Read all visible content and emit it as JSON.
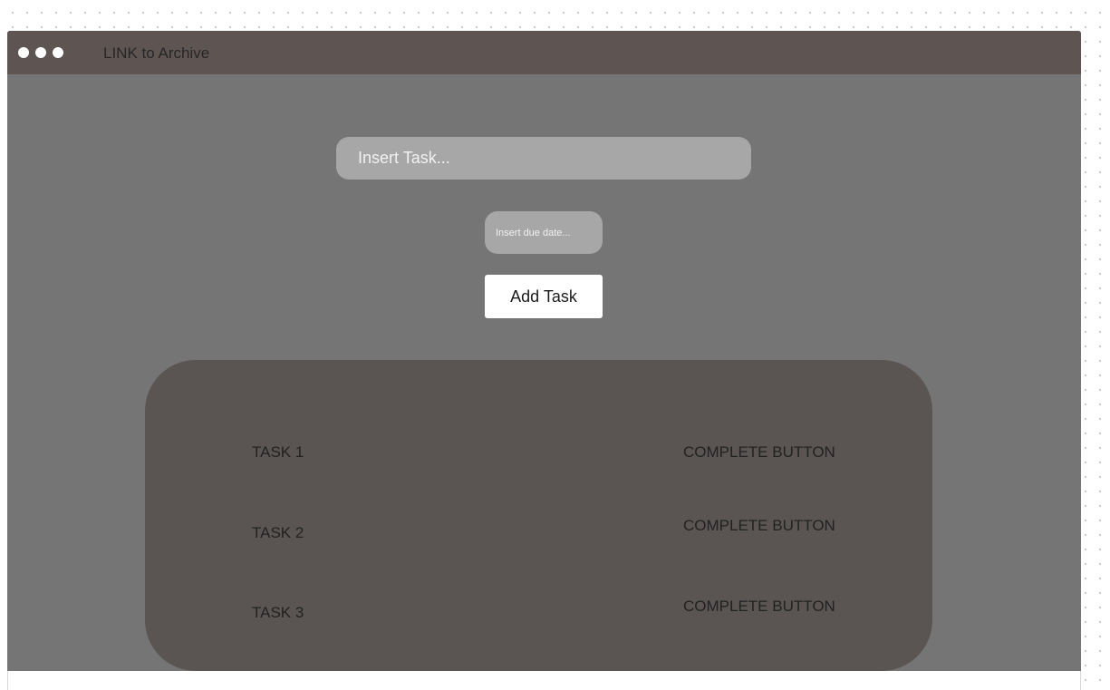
{
  "titlebar": {
    "archive_link": "LINK to Archive"
  },
  "form": {
    "task_placeholder": "Insert Task...",
    "due_date_placeholder": "Insert due date...",
    "add_button_label": "Add Task"
  },
  "tasks": [
    {
      "name": "TASK 1",
      "action_label": "COMPLETE BUTTON"
    },
    {
      "name": "TASK 2",
      "action_label": "COMPLETE BUTTON"
    },
    {
      "name": "TASK 3",
      "action_label": "COMPLETE BUTTON"
    }
  ],
  "colors": {
    "titlebar": "#5e5553",
    "window_background": "#757575",
    "input_background": "#a7a7a7",
    "task_panel": "#5a5553",
    "button_background": "#ffffff"
  }
}
